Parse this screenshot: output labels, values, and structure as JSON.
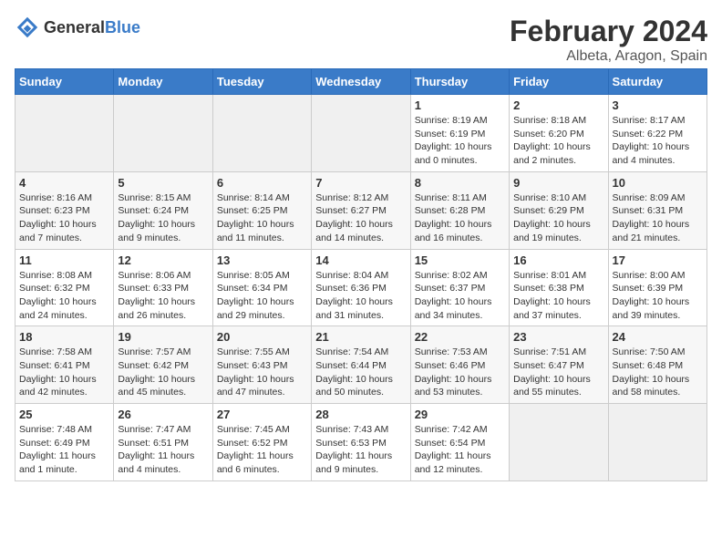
{
  "logo": {
    "text_general": "General",
    "text_blue": "Blue"
  },
  "header": {
    "title": "February 2024",
    "subtitle": "Albeta, Aragon, Spain"
  },
  "weekdays": [
    "Sunday",
    "Monday",
    "Tuesday",
    "Wednesday",
    "Thursday",
    "Friday",
    "Saturday"
  ],
  "weeks": [
    [
      {
        "day": "",
        "empty": true
      },
      {
        "day": "",
        "empty": true
      },
      {
        "day": "",
        "empty": true
      },
      {
        "day": "",
        "empty": true
      },
      {
        "day": "1",
        "sunrise": "8:19 AM",
        "sunset": "6:19 PM",
        "daylight": "10 hours and 0 minutes."
      },
      {
        "day": "2",
        "sunrise": "8:18 AM",
        "sunset": "6:20 PM",
        "daylight": "10 hours and 2 minutes."
      },
      {
        "day": "3",
        "sunrise": "8:17 AM",
        "sunset": "6:22 PM",
        "daylight": "10 hours and 4 minutes."
      }
    ],
    [
      {
        "day": "4",
        "sunrise": "8:16 AM",
        "sunset": "6:23 PM",
        "daylight": "10 hours and 7 minutes."
      },
      {
        "day": "5",
        "sunrise": "8:15 AM",
        "sunset": "6:24 PM",
        "daylight": "10 hours and 9 minutes."
      },
      {
        "day": "6",
        "sunrise": "8:14 AM",
        "sunset": "6:25 PM",
        "daylight": "10 hours and 11 minutes."
      },
      {
        "day": "7",
        "sunrise": "8:12 AM",
        "sunset": "6:27 PM",
        "daylight": "10 hours and 14 minutes."
      },
      {
        "day": "8",
        "sunrise": "8:11 AM",
        "sunset": "6:28 PM",
        "daylight": "10 hours and 16 minutes."
      },
      {
        "day": "9",
        "sunrise": "8:10 AM",
        "sunset": "6:29 PM",
        "daylight": "10 hours and 19 minutes."
      },
      {
        "day": "10",
        "sunrise": "8:09 AM",
        "sunset": "6:31 PM",
        "daylight": "10 hours and 21 minutes."
      }
    ],
    [
      {
        "day": "11",
        "sunrise": "8:08 AM",
        "sunset": "6:32 PM",
        "daylight": "10 hours and 24 minutes."
      },
      {
        "day": "12",
        "sunrise": "8:06 AM",
        "sunset": "6:33 PM",
        "daylight": "10 hours and 26 minutes."
      },
      {
        "day": "13",
        "sunrise": "8:05 AM",
        "sunset": "6:34 PM",
        "daylight": "10 hours and 29 minutes."
      },
      {
        "day": "14",
        "sunrise": "8:04 AM",
        "sunset": "6:36 PM",
        "daylight": "10 hours and 31 minutes."
      },
      {
        "day": "15",
        "sunrise": "8:02 AM",
        "sunset": "6:37 PM",
        "daylight": "10 hours and 34 minutes."
      },
      {
        "day": "16",
        "sunrise": "8:01 AM",
        "sunset": "6:38 PM",
        "daylight": "10 hours and 37 minutes."
      },
      {
        "day": "17",
        "sunrise": "8:00 AM",
        "sunset": "6:39 PM",
        "daylight": "10 hours and 39 minutes."
      }
    ],
    [
      {
        "day": "18",
        "sunrise": "7:58 AM",
        "sunset": "6:41 PM",
        "daylight": "10 hours and 42 minutes."
      },
      {
        "day": "19",
        "sunrise": "7:57 AM",
        "sunset": "6:42 PM",
        "daylight": "10 hours and 45 minutes."
      },
      {
        "day": "20",
        "sunrise": "7:55 AM",
        "sunset": "6:43 PM",
        "daylight": "10 hours and 47 minutes."
      },
      {
        "day": "21",
        "sunrise": "7:54 AM",
        "sunset": "6:44 PM",
        "daylight": "10 hours and 50 minutes."
      },
      {
        "day": "22",
        "sunrise": "7:53 AM",
        "sunset": "6:46 PM",
        "daylight": "10 hours and 53 minutes."
      },
      {
        "day": "23",
        "sunrise": "7:51 AM",
        "sunset": "6:47 PM",
        "daylight": "10 hours and 55 minutes."
      },
      {
        "day": "24",
        "sunrise": "7:50 AM",
        "sunset": "6:48 PM",
        "daylight": "10 hours and 58 minutes."
      }
    ],
    [
      {
        "day": "25",
        "sunrise": "7:48 AM",
        "sunset": "6:49 PM",
        "daylight": "11 hours and 1 minute."
      },
      {
        "day": "26",
        "sunrise": "7:47 AM",
        "sunset": "6:51 PM",
        "daylight": "11 hours and 4 minutes."
      },
      {
        "day": "27",
        "sunrise": "7:45 AM",
        "sunset": "6:52 PM",
        "daylight": "11 hours and 6 minutes."
      },
      {
        "day": "28",
        "sunrise": "7:43 AM",
        "sunset": "6:53 PM",
        "daylight": "11 hours and 9 minutes."
      },
      {
        "day": "29",
        "sunrise": "7:42 AM",
        "sunset": "6:54 PM",
        "daylight": "11 hours and 12 minutes."
      },
      {
        "day": "",
        "empty": true
      },
      {
        "day": "",
        "empty": true
      }
    ]
  ],
  "labels": {
    "sunrise": "Sunrise:",
    "sunset": "Sunset:",
    "daylight": "Daylight hours"
  }
}
